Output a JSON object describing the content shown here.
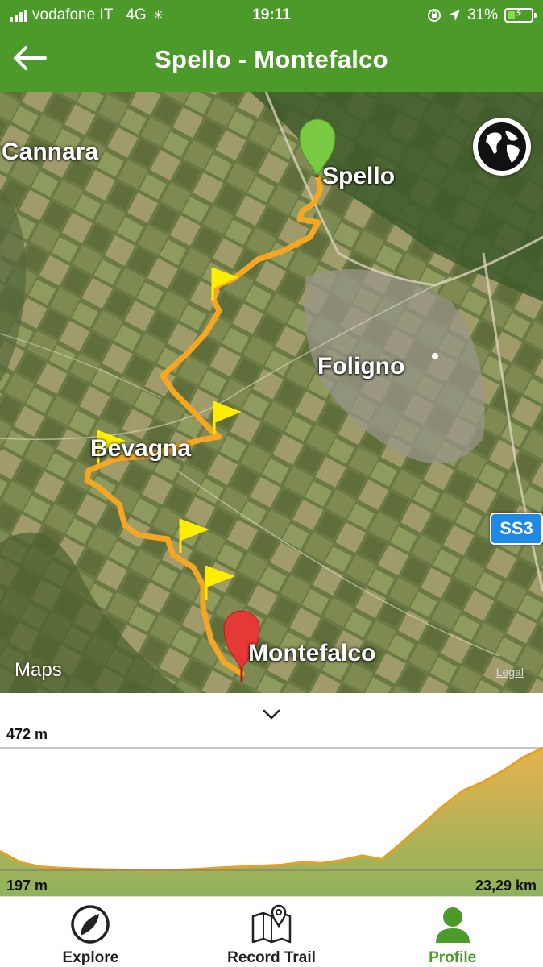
{
  "status_bar": {
    "carrier": "vodafone IT",
    "network": "4G",
    "time": "19:11",
    "battery_percent": "31%",
    "battery_level": 0.31
  },
  "header": {
    "title": "Spello - Montefalco",
    "back_icon": "arrow-left-icon"
  },
  "map": {
    "labels": {
      "cannara": "Cannara",
      "spello": "Spello",
      "foligno": "Foligno",
      "bevagna": "Bevagna",
      "montefalco": "Montefalco"
    },
    "road_shield": "SS3",
    "attribution": "Maps",
    "legal": "Legal",
    "route_color": "#f5a623",
    "start_pin_color": "#7ac943",
    "end_pin_color": "#e53935",
    "waypoint_flag_color": "#ffee00"
  },
  "elevation": {
    "max_label": "472 m",
    "min_label": "197 m",
    "distance_label": "23,29 km",
    "fill_color": "#e6b24f",
    "profile_m": [
      240,
      215,
      205,
      202,
      200,
      199,
      198,
      197,
      197,
      198,
      200,
      203,
      205,
      207,
      209,
      215,
      213,
      220,
      230,
      222,
      260,
      300,
      340,
      375,
      395,
      420,
      450,
      472
    ]
  },
  "tabs": [
    {
      "id": "explore",
      "label": "Explore",
      "icon": "compass-icon",
      "active": false
    },
    {
      "id": "record",
      "label": "Record Trail",
      "icon": "map-pin-icon",
      "active": false
    },
    {
      "id": "profile",
      "label": "Profile",
      "icon": "user-icon",
      "active": true
    }
  ],
  "accent_color": "#4c9a2a"
}
